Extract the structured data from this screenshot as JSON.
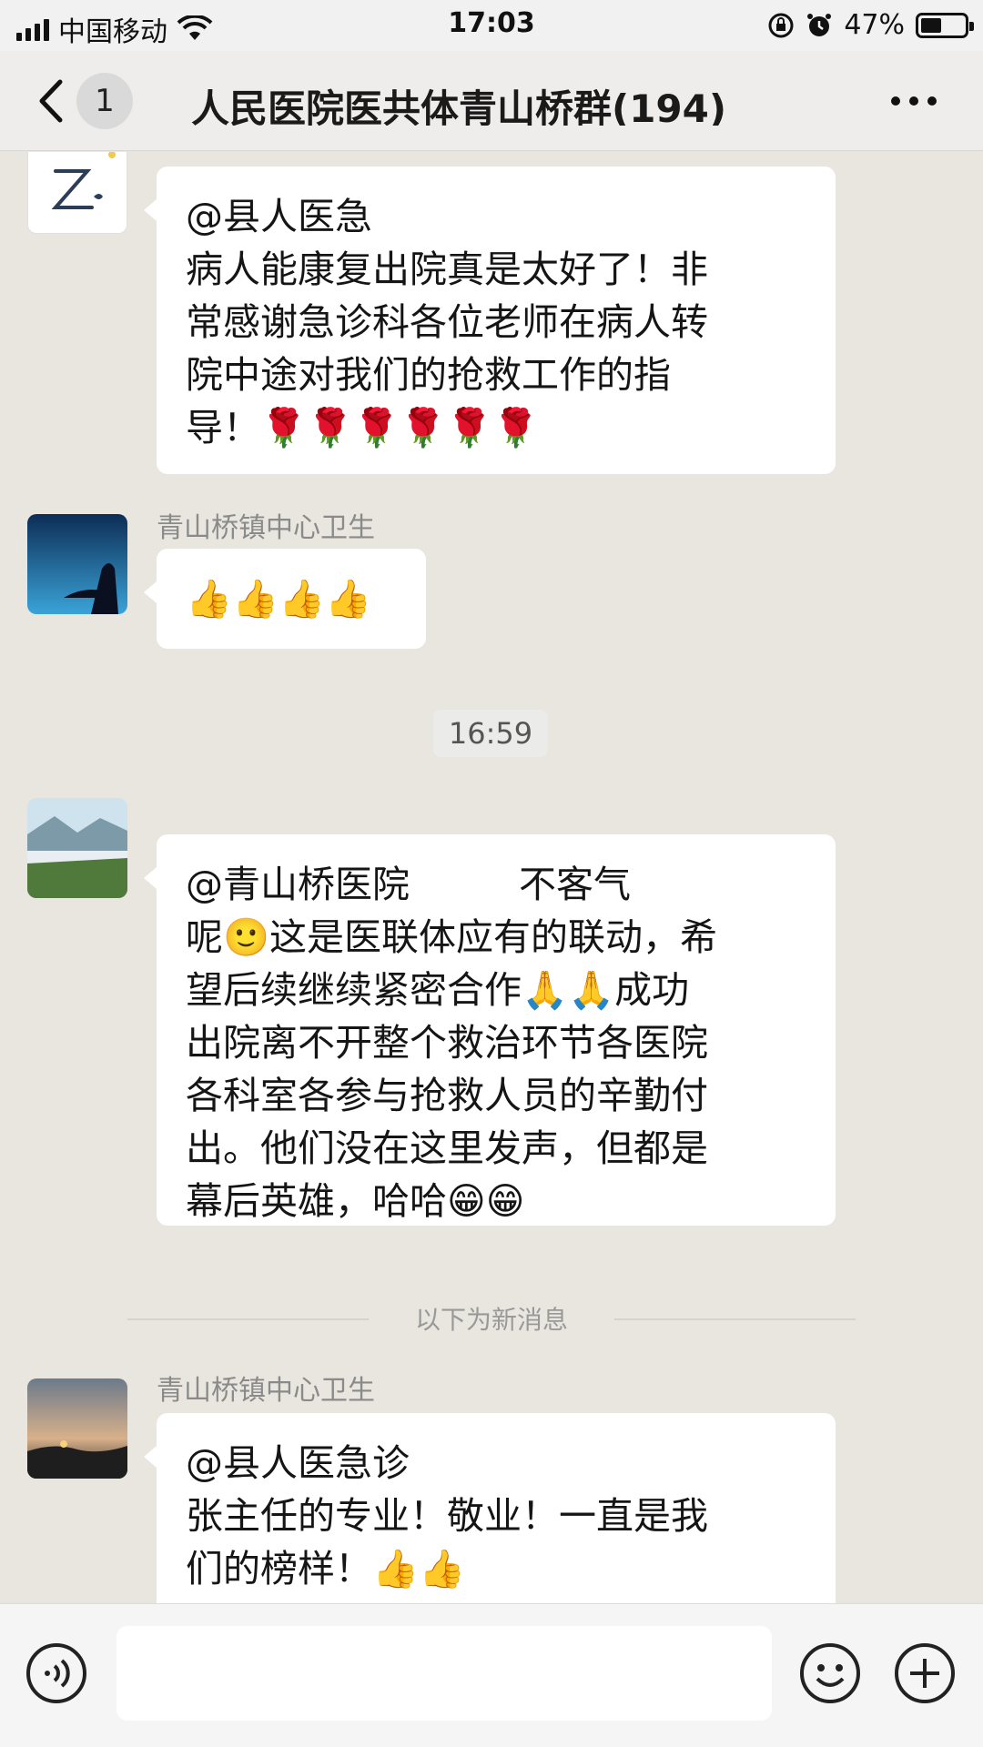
{
  "status_bar": {
    "carrier": "中国移动",
    "time": "17:03",
    "battery_percent": "47%",
    "battery_level": 0.47,
    "icons": [
      "signal-icon",
      "wifi-icon",
      "orientation-lock-icon",
      "alarm-icon",
      "battery-icon"
    ]
  },
  "nav": {
    "back_icon": "chevron-left-icon",
    "unread_count": "1",
    "title": "人民医院医共体青山桥群(194)",
    "more_icon": "more-dots-icon"
  },
  "messages": [
    {
      "sender": "",
      "avatar": "avatar-z-letter",
      "lines": [
        "@县人医急",
        "病人能康复出院真是太好了！非",
        "常感谢急诊科各位老师在病人转",
        "院中途对我们的抢救工作的指",
        "导！🌹🌹🌹🌹🌹🌹"
      ]
    },
    {
      "sender": "青山桥镇中心卫生",
      "avatar": "avatar-night-silhouette",
      "lines": [
        "👍👍👍👍"
      ]
    },
    {
      "sender": "",
      "avatar": "avatar-mountain-landscape",
      "lines": [
        "@青山桥医院",
        "不客气",
        "呢🙂这是医联体应有的联动，希",
        "望后续继续紧密合作🙏🙏成功",
        "出院离不开整个救治环节各医院",
        "各科室各参与抢救人员的辛勤付",
        "出。他们没在这里发声，但都是",
        "幕后英雄，哈哈😁😁"
      ]
    },
    {
      "sender": "青山桥镇中心卫生",
      "avatar": "avatar-sunset",
      "lines": [
        "@县人医急诊",
        "张主任的专业！敬业！一直是我",
        "们的榜样！👍👍"
      ]
    }
  ],
  "time_divider": "16:59",
  "new_messages_label": "以下为新消息",
  "input_bar": {
    "placeholder": "",
    "icons": [
      "voice-icon",
      "emoji-icon",
      "add-icon"
    ]
  }
}
